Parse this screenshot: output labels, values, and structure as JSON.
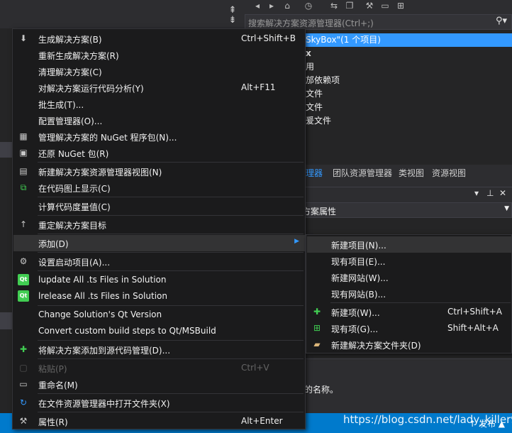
{
  "solution_explorer": {
    "search_placeholder": "搜索解决方案资源管理器(Ctrl+;)",
    "tree": [
      {
        "text": "SkyBox\"(1 个项目)",
        "selected": true
      },
      {
        "text": "x",
        "bold": true
      },
      {
        "text": "用"
      },
      {
        "text": "邡依赖项"
      },
      {
        "text": "文件"
      },
      {
        "text": "文件"
      },
      {
        "text": "爰文件"
      }
    ],
    "tabs": [
      "理器",
      "团队资源管理器",
      "类视图",
      "资源视图"
    ]
  },
  "properties": {
    "combo_text": "方案属性",
    "description": "的名称。"
  },
  "statusbar": {
    "publish": "↑ 发布 ▲",
    "watermark": "https://blog.csdn.net/lady_killer9"
  },
  "context_menu": {
    "items": [
      {
        "label": "生成解决方案(B)",
        "shortcut": "Ctrl+Shift+B",
        "icon": "build-icon"
      },
      {
        "label": "重新生成解决方案(R)",
        "shortcut": ""
      },
      {
        "label": "清理解决方案(C)",
        "shortcut": ""
      },
      {
        "label": "对解决方案运行代码分析(Y)",
        "shortcut": "Alt+F11"
      },
      {
        "label": "批生成(T)...",
        "shortcut": ""
      },
      {
        "label": "配置管理器(O)...",
        "shortcut": ""
      },
      {
        "label": "管理解决方案的 NuGet 程序包(N)...",
        "shortcut": "",
        "icon": "nuget-icon"
      },
      {
        "label": "还原 NuGet 包(R)",
        "shortcut": "",
        "icon": "restore-icon"
      },
      {
        "label": "新建解决方案资源管理器视图(N)",
        "shortcut": "",
        "icon": "new-view-icon"
      },
      {
        "label": "在代码图上显示(C)",
        "shortcut": "",
        "icon": "code-map-icon"
      },
      {
        "label": "计算代码度量值(C)",
        "shortcut": ""
      },
      {
        "label": "重定解决方案目标",
        "shortcut": "",
        "icon": "retarget-icon"
      },
      {
        "label": "添加(D)",
        "shortcut": ""
      },
      {
        "label": "设置启动项目(A)...",
        "shortcut": "",
        "icon": "gear-icon"
      },
      {
        "label": "lupdate All .ts Files in Solution",
        "shortcut": "",
        "icon": "qt-icon"
      },
      {
        "label": "lrelease All .ts Files in Solution",
        "shortcut": "",
        "icon": "qt-icon"
      },
      {
        "label": "Change Solution's Qt Version",
        "shortcut": ""
      },
      {
        "label": "Convert custom build steps to Qt/MSBuild",
        "shortcut": ""
      },
      {
        "label": "将解决方案添加到源代码管理(D)...",
        "shortcut": "",
        "icon": "source-control-icon"
      },
      {
        "label": "粘贴(P)",
        "shortcut": "Ctrl+V",
        "icon": "paste-icon"
      },
      {
        "label": "重命名(M)",
        "shortcut": "",
        "icon": "rename-icon"
      },
      {
        "label": "在文件资源管理器中打开文件夹(X)",
        "shortcut": "",
        "icon": "open-folder-icon"
      },
      {
        "label": "属性(R)",
        "shortcut": "Alt+Enter",
        "icon": "wrench-icon"
      }
    ]
  },
  "submenu": {
    "items": [
      {
        "label": "新建项目(N)...",
        "shortcut": ""
      },
      {
        "label": "现有项目(E)...",
        "shortcut": ""
      },
      {
        "label": "新建网站(W)...",
        "shortcut": ""
      },
      {
        "label": "现有网站(B)...",
        "shortcut": ""
      },
      {
        "label": "新建项(W)...",
        "shortcut": "Ctrl+Shift+A",
        "icon": "new-item-icon"
      },
      {
        "label": "现有项(G)...",
        "shortcut": "Shift+Alt+A",
        "icon": "existing-item-icon"
      },
      {
        "label": "新建解决方案文件夹(D)",
        "shortcut": "",
        "icon": "folder-icon"
      }
    ]
  }
}
